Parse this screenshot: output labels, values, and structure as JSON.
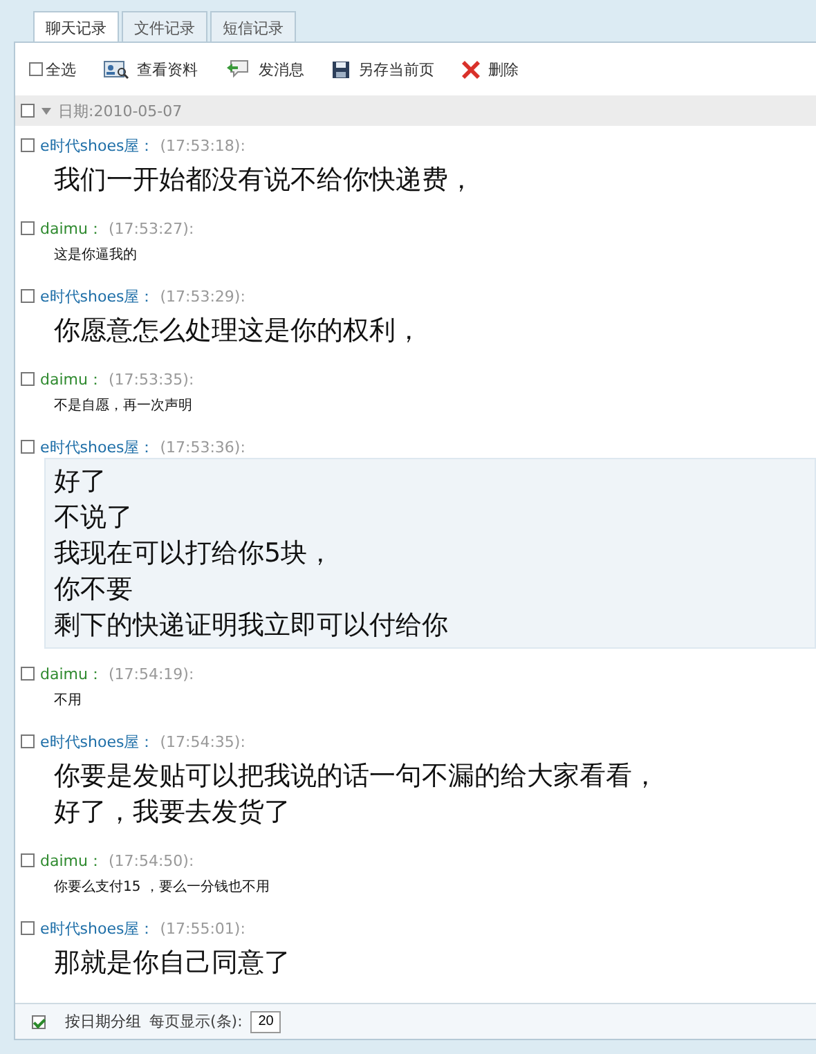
{
  "tabs": [
    {
      "label": "聊天记录",
      "selected": true
    },
    {
      "label": "文件记录",
      "selected": false
    },
    {
      "label": "短信记录",
      "selected": false
    }
  ],
  "toolbar": {
    "select_all": {
      "label": "全选",
      "checked": false
    },
    "buttons": [
      {
        "kind": "profile",
        "label": "查看资料"
      },
      {
        "kind": "message",
        "label": "发消息"
      },
      {
        "kind": "save",
        "label": "另存当前页"
      },
      {
        "kind": "delete",
        "label": "删除"
      }
    ]
  },
  "date_group": {
    "label": "日期:2010-05-07",
    "checked": false,
    "expanded": true
  },
  "messages": [
    {
      "sender": "e时代shoes屋：",
      "time": "(17:53:18):",
      "color": "#1f6fa8",
      "checked": false,
      "selected": false,
      "kind": "large",
      "lines": [
        "我们一开始都没有说不给你快递费，"
      ]
    },
    {
      "sender": "daimu：",
      "time": "(17:53:27):",
      "color": "#2f8a2f",
      "checked": false,
      "selected": false,
      "kind": "small",
      "lines": [
        "这是你逼我的"
      ]
    },
    {
      "sender": "e时代shoes屋：",
      "time": "(17:53:29):",
      "color": "#1f6fa8",
      "checked": false,
      "selected": false,
      "kind": "large",
      "lines": [
        "你愿意怎么处理这是你的权利，"
      ]
    },
    {
      "sender": "daimu：",
      "time": "(17:53:35):",
      "color": "#2f8a2f",
      "checked": false,
      "selected": false,
      "kind": "small",
      "lines": [
        "不是自愿，再一次声明"
      ]
    },
    {
      "sender": "e时代shoes屋：",
      "time": "(17:53:36):",
      "color": "#1f6fa8",
      "checked": false,
      "selected": true,
      "kind": "large",
      "lines": [
        "好了",
        "不说了",
        "我现在可以打给你5块，",
        "你不要",
        "剩下的快递证明我立即可以付给你"
      ]
    },
    {
      "sender": "daimu：",
      "time": "(17:54:19):",
      "color": "#2f8a2f",
      "checked": false,
      "selected": false,
      "kind": "small",
      "lines": [
        "不用"
      ]
    },
    {
      "sender": "e时代shoes屋：",
      "time": "(17:54:35):",
      "color": "#1f6fa8",
      "checked": false,
      "selected": false,
      "kind": "large",
      "lines": [
        "你要是发贴可以把我说的话一句不漏的给大家看看，",
        "好了，我要去发货了"
      ]
    },
    {
      "sender": "daimu：",
      "time": "(17:54:50):",
      "color": "#2f8a2f",
      "checked": false,
      "selected": false,
      "kind": "small",
      "lines": [
        "你要么支付15 ，要么一分钱也不用"
      ]
    },
    {
      "sender": "e时代shoes屋：",
      "time": "(17:55:01):",
      "color": "#1f6fa8",
      "checked": false,
      "selected": false,
      "kind": "large",
      "lines": [
        "那就是你自己同意了"
      ]
    }
  ],
  "footer": {
    "group_by_date": {
      "label": "按日期分组",
      "checked": true
    },
    "per_page_label": "每页显示(条):",
    "per_page_value": "20"
  }
}
